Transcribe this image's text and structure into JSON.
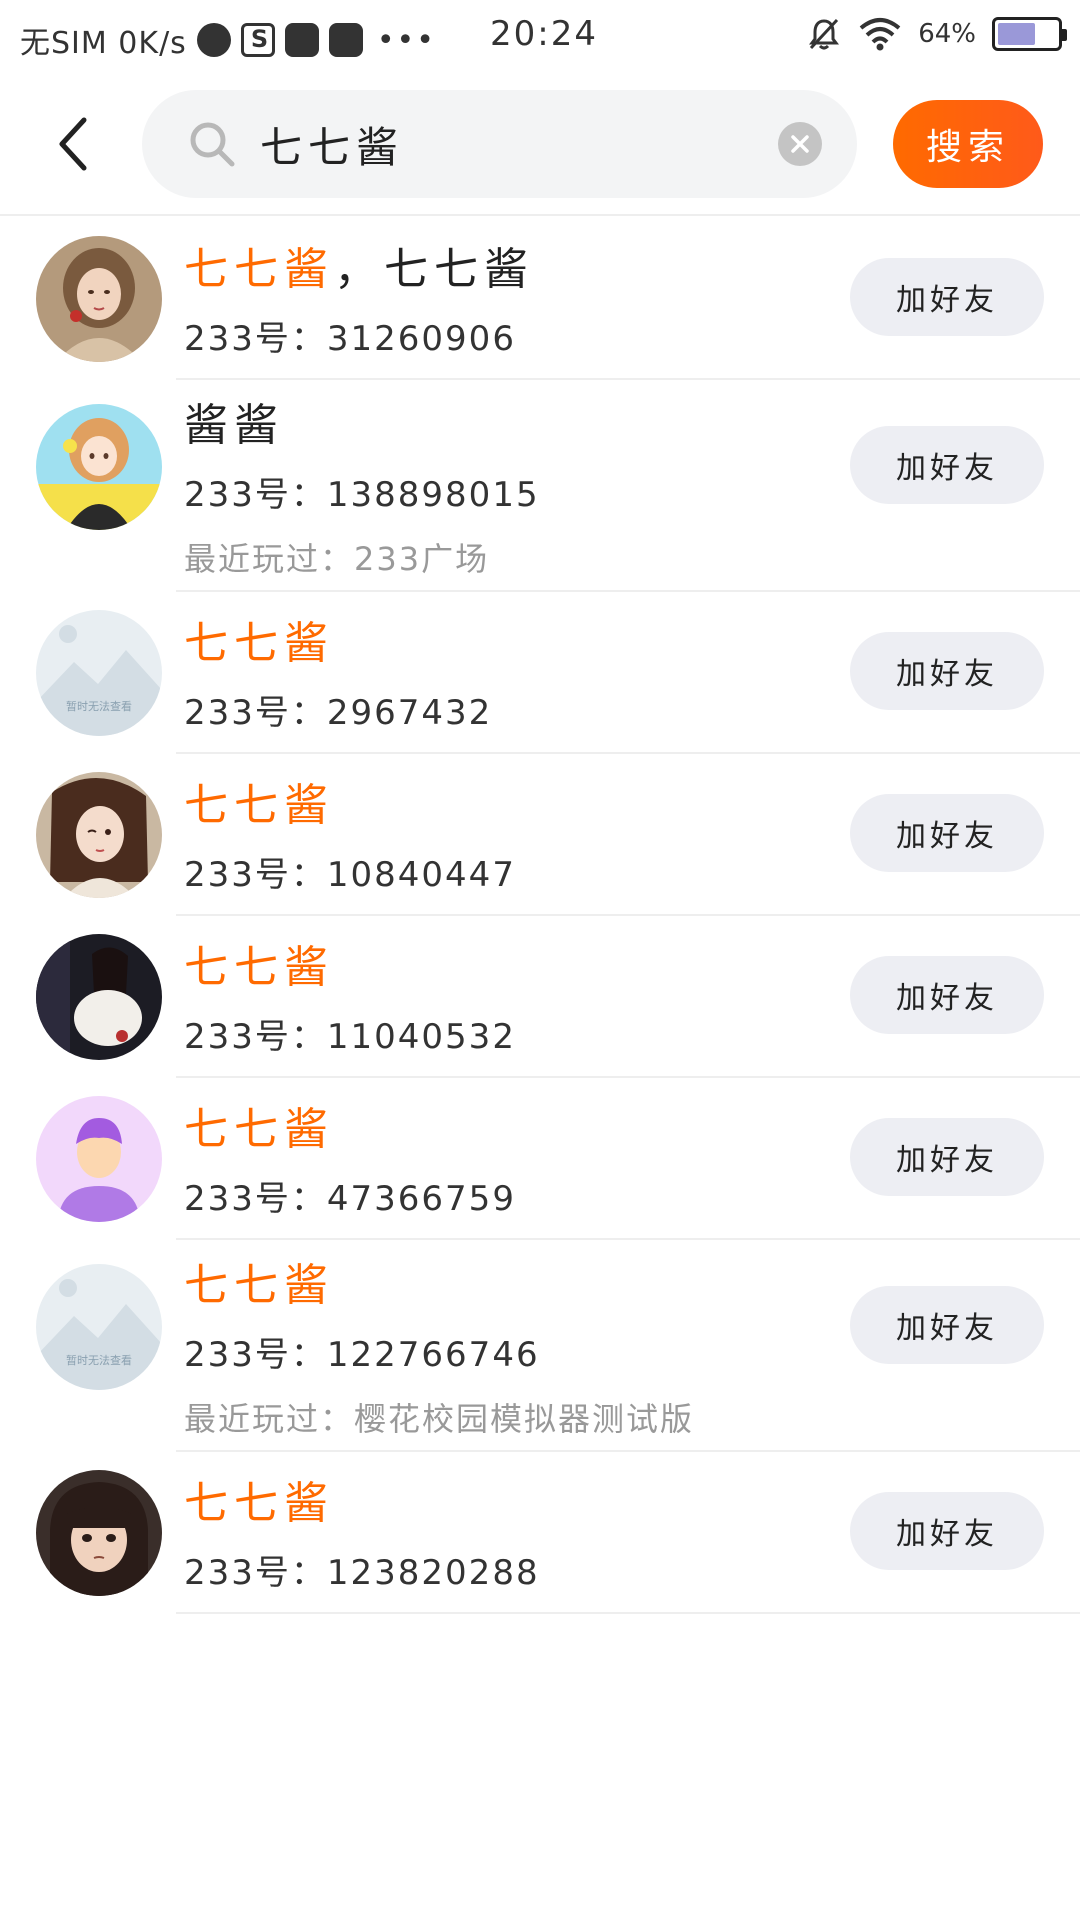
{
  "status_bar": {
    "carrier": "无SIM 0K/s",
    "time": "20:24",
    "battery_pct": "64%",
    "battery_level": 0.64,
    "icons": [
      "planet-icon",
      "s-app-icon",
      "bag-icon",
      "bag-icon",
      "more-dots-icon",
      "bell-muted-icon",
      "wifi-icon",
      "battery-icon"
    ]
  },
  "header": {
    "search_value": "七七酱",
    "search_label": "搜索"
  },
  "results": [
    {
      "name_highlight": "七七酱",
      "name_rest": "，七七酱",
      "id_text": "233号：31260906",
      "recent": "",
      "avatar": "girl-painting",
      "add_label": "加好友"
    },
    {
      "name_highlight": "",
      "name_rest": "酱酱",
      "id_text": "233号：138898015",
      "recent": "最近玩过：233广场",
      "avatar": "anime-girl-yellow",
      "add_label": "加好友"
    },
    {
      "name_highlight": "七七酱",
      "name_rest": "",
      "id_text": "233号：2967432",
      "recent": "",
      "avatar": "placeholder",
      "add_label": "加好友",
      "placeholder_text": "暂时无法查看"
    },
    {
      "name_highlight": "七七酱",
      "name_rest": "",
      "id_text": "233号：10840447",
      "recent": "",
      "avatar": "anime-girl-brown",
      "add_label": "加好友"
    },
    {
      "name_highlight": "七七酱",
      "name_rest": "",
      "id_text": "233号：11040532",
      "recent": "",
      "avatar": "dark-photo",
      "add_label": "加好友"
    },
    {
      "name_highlight": "七七酱",
      "name_rest": "",
      "id_text": "233号：47366759",
      "recent": "",
      "avatar": "default-purple",
      "add_label": "加好友"
    },
    {
      "name_highlight": "七七酱",
      "name_rest": "",
      "id_text": "233号：122766746",
      "recent": "最近玩过：樱花校园模拟器测试版",
      "avatar": "placeholder",
      "add_label": "加好友",
      "placeholder_text": "暂时无法查看"
    },
    {
      "name_highlight": "七七酱",
      "name_rest": "",
      "id_text": "233号：123820288",
      "recent": "",
      "avatar": "anime-boy",
      "add_label": "加好友"
    }
  ],
  "colors": {
    "accent": "#ff6a00",
    "button_bg": "#edeef3",
    "search_bg": "#f3f4f5",
    "muted_text": "#999999"
  }
}
